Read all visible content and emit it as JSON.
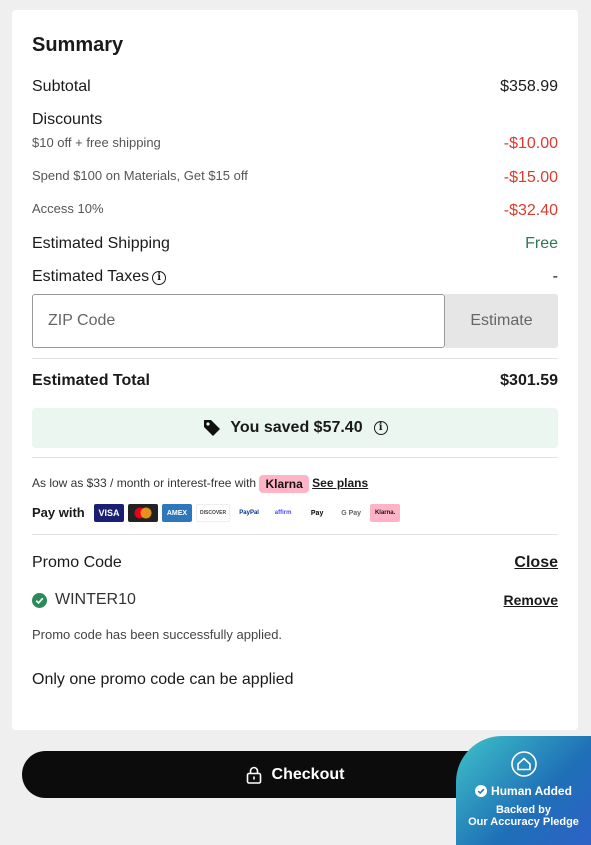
{
  "summary": {
    "title": "Summary",
    "subtotal_label": "Subtotal",
    "subtotal_value": "$358.99",
    "discounts_label": "Discounts",
    "discounts": [
      {
        "label": "$10 off + free shipping",
        "value": "-$10.00"
      },
      {
        "label": "Spend $100 on Materials, Get $15 off",
        "value": "-$15.00"
      },
      {
        "label": "Access 10%",
        "value": "-$32.40"
      }
    ],
    "shipping_label": "Estimated Shipping",
    "shipping_value": "Free",
    "taxes_label": "Estimated Taxes",
    "taxes_value": "-",
    "zip_placeholder": "ZIP Code",
    "estimate_label": "Estimate",
    "total_label": "Estimated Total",
    "total_value": "$301.59",
    "saved_text": "You saved $57.40"
  },
  "financing": {
    "text": "As low as $33 / month or interest-free with",
    "klarna": "Klarna",
    "see_plans": "See plans",
    "pay_with": "Pay with",
    "methods": [
      "VISA",
      "MC",
      "AMEX",
      "DISCOVER",
      "PayPal",
      "affirm",
      "Pay",
      "G Pay",
      "Klarna."
    ]
  },
  "promo": {
    "title": "Promo Code",
    "close_label": "Close",
    "code": "WINTER10",
    "remove_label": "Remove",
    "success_text": "Promo code has been successfully applied.",
    "note": "Only one promo code can be applied"
  },
  "checkout": {
    "label": "Checkout"
  },
  "badge": {
    "title": "Human Added",
    "line1": "Backed by",
    "line2": "Our Accuracy Pledge"
  },
  "colors": {
    "discount": "#d93b2f",
    "free": "#2b7a4f",
    "saved_bg": "#eaf6ef",
    "klarna": "#ffb3c7",
    "success": "#2b8a5a"
  }
}
